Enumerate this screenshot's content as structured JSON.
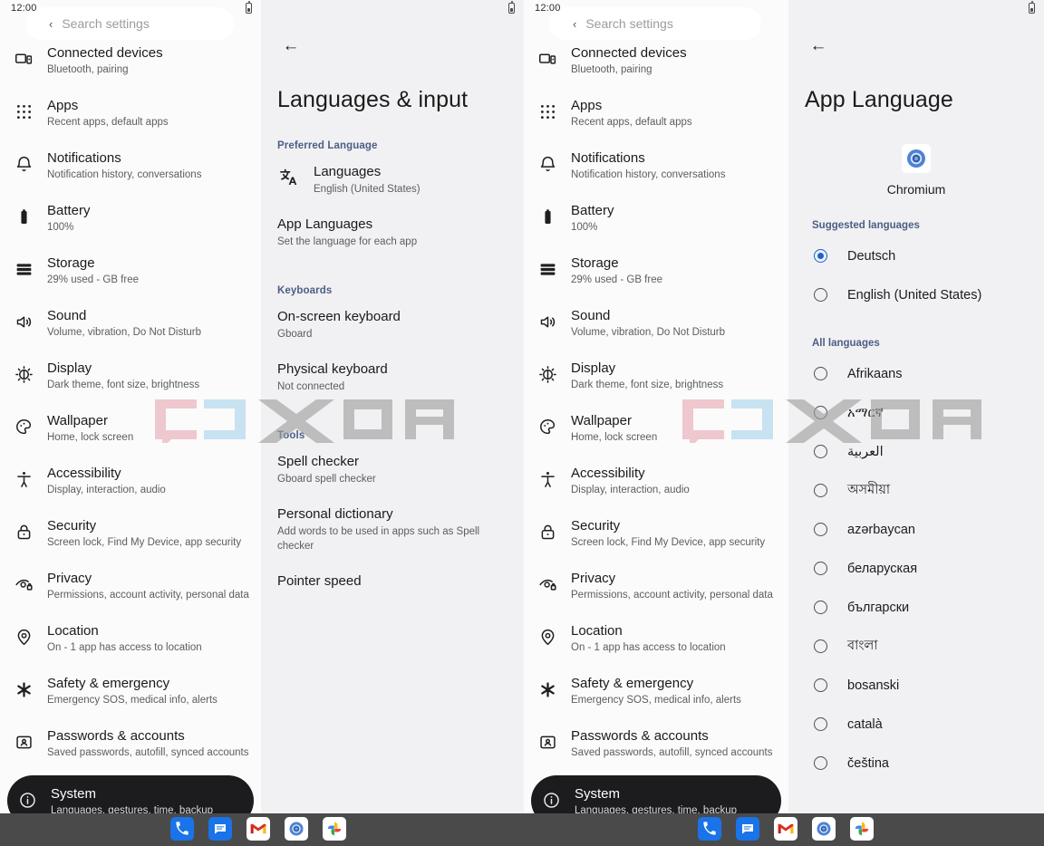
{
  "statusbar": {
    "clock": "12:00",
    "battery_icon": "battery-icon"
  },
  "settings_panel": {
    "search_placeholder": "Search settings",
    "items": [
      {
        "icon": "connected-devices-icon",
        "title": "Connected devices",
        "subtitle": "Bluetooth, pairing"
      },
      {
        "icon": "apps-grid-icon",
        "title": "Apps",
        "subtitle": "Recent apps, default apps"
      },
      {
        "icon": "bell-icon",
        "title": "Notifications",
        "subtitle": "Notification history, conversations"
      },
      {
        "icon": "battery-icon",
        "title": "Battery",
        "subtitle": "100%"
      },
      {
        "icon": "storage-icon",
        "title": "Storage",
        "subtitle": "29% used -      GB free"
      },
      {
        "icon": "speaker-icon",
        "title": "Sound",
        "subtitle": "Volume, vibration, Do Not Disturb"
      },
      {
        "icon": "brightness-icon",
        "title": "Display",
        "subtitle": "Dark theme, font size, brightness"
      },
      {
        "icon": "palette-icon",
        "title": "Wallpaper",
        "subtitle": "Home, lock screen"
      },
      {
        "icon": "accessibility-icon",
        "title": "Accessibility",
        "subtitle": "Display, interaction, audio"
      },
      {
        "icon": "lock-icon",
        "title": "Security",
        "subtitle": "Screen lock, Find My Device, app security"
      },
      {
        "icon": "privacy-eye-icon",
        "title": "Privacy",
        "subtitle": "Permissions, account activity, personal data"
      },
      {
        "icon": "location-pin-icon",
        "title": "Location",
        "subtitle": "On - 1 app has access to location"
      },
      {
        "icon": "asterisk-icon",
        "title": "Safety & emergency",
        "subtitle": "Emergency SOS, medical info, alerts"
      },
      {
        "icon": "passwords-icon",
        "title": "Passwords & accounts",
        "subtitle": "Saved passwords, autofill, synced accounts"
      },
      {
        "icon": "info-circle-icon",
        "title": "System",
        "subtitle": "Languages, gestures, time, backup",
        "selected": true
      }
    ]
  },
  "languages_input_panel": {
    "back_icon": "back-arrow-icon",
    "title": "Languages & input",
    "sections": [
      {
        "header": "Preferred Language",
        "rows": [
          {
            "icon": "translate-icon",
            "title": "Languages",
            "subtitle": "English (United States)"
          },
          {
            "icon": "",
            "title": "App Languages",
            "subtitle": "Set the language for each app"
          }
        ]
      },
      {
        "header": "Keyboards",
        "rows": [
          {
            "icon": "",
            "title": "On-screen keyboard",
            "subtitle": "Gboard"
          },
          {
            "icon": "",
            "title": "Physical keyboard",
            "subtitle": "Not connected"
          }
        ]
      },
      {
        "header": "Tools",
        "rows": [
          {
            "icon": "",
            "title": "Spell checker",
            "subtitle": "Gboard spell checker"
          },
          {
            "icon": "",
            "title": "Personal dictionary",
            "subtitle": "Add words to be used in apps such as Spell checker"
          },
          {
            "icon": "",
            "title": "Pointer speed",
            "subtitle": ""
          }
        ]
      }
    ]
  },
  "app_language_panel": {
    "back_icon": "back-arrow-icon",
    "title": "App Language",
    "app_icon": "chromium-icon",
    "app_name": "Chromium",
    "suggested_header": "Suggested languages",
    "suggested": [
      {
        "name": "Deutsch",
        "selected": true
      },
      {
        "name": "English (United States)",
        "selected": false
      }
    ],
    "all_header": "All languages",
    "all": [
      {
        "name": "Afrikaans",
        "selected": false
      },
      {
        "name": "አማርኛ",
        "selected": false
      },
      {
        "name": "العربية",
        "selected": false
      },
      {
        "name": "অসমীয়া",
        "selected": false
      },
      {
        "name": "azərbaycan",
        "selected": false
      },
      {
        "name": "беларуская",
        "selected": false
      },
      {
        "name": "български",
        "selected": false
      },
      {
        "name": "বাংলা",
        "selected": false
      },
      {
        "name": "bosanski",
        "selected": false
      },
      {
        "name": "català",
        "selected": false
      },
      {
        "name": "čeština",
        "selected": false
      }
    ]
  },
  "watermark": {
    "text": "XDA"
  },
  "dock": {
    "apps": [
      {
        "name": "phone-app-icon",
        "label": "Phone"
      },
      {
        "name": "messages-app-icon",
        "label": "Messages"
      },
      {
        "name": "gmail-app-icon",
        "label": "Gmail"
      },
      {
        "name": "chromium-app-icon",
        "label": "Chromium"
      },
      {
        "name": "photos-app-icon",
        "label": "Photos"
      }
    ]
  },
  "colors": {
    "accent_blue": "#1a62d6",
    "section_header": "#4c5e85",
    "selected_pill": "#1c1c1e",
    "dock_bar": "#4a4a4a"
  }
}
